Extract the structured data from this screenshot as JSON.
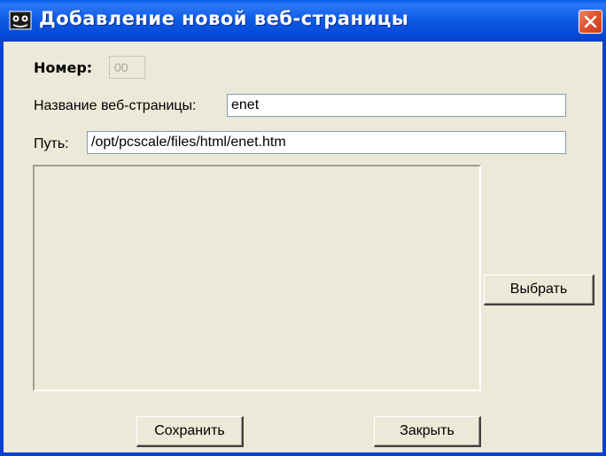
{
  "window": {
    "title": "Добавление новой веб-страницы",
    "icon": "app-icon",
    "close_icon": "close-icon"
  },
  "form": {
    "number_label": "Номер:",
    "number_value": "00",
    "name_label": "Название веб-страницы:",
    "name_value": "enet",
    "path_label": "Путь:",
    "path_value": "/opt/pcscale/files/html/enet.htm"
  },
  "buttons": {
    "choose_label": "Выбрать",
    "save_label": "Сохранить",
    "close_label": "Закрыть"
  },
  "colors": {
    "titlebar": "#0a5ae4",
    "window_bg": "#ece9d8",
    "close_button": "#e2542c"
  }
}
